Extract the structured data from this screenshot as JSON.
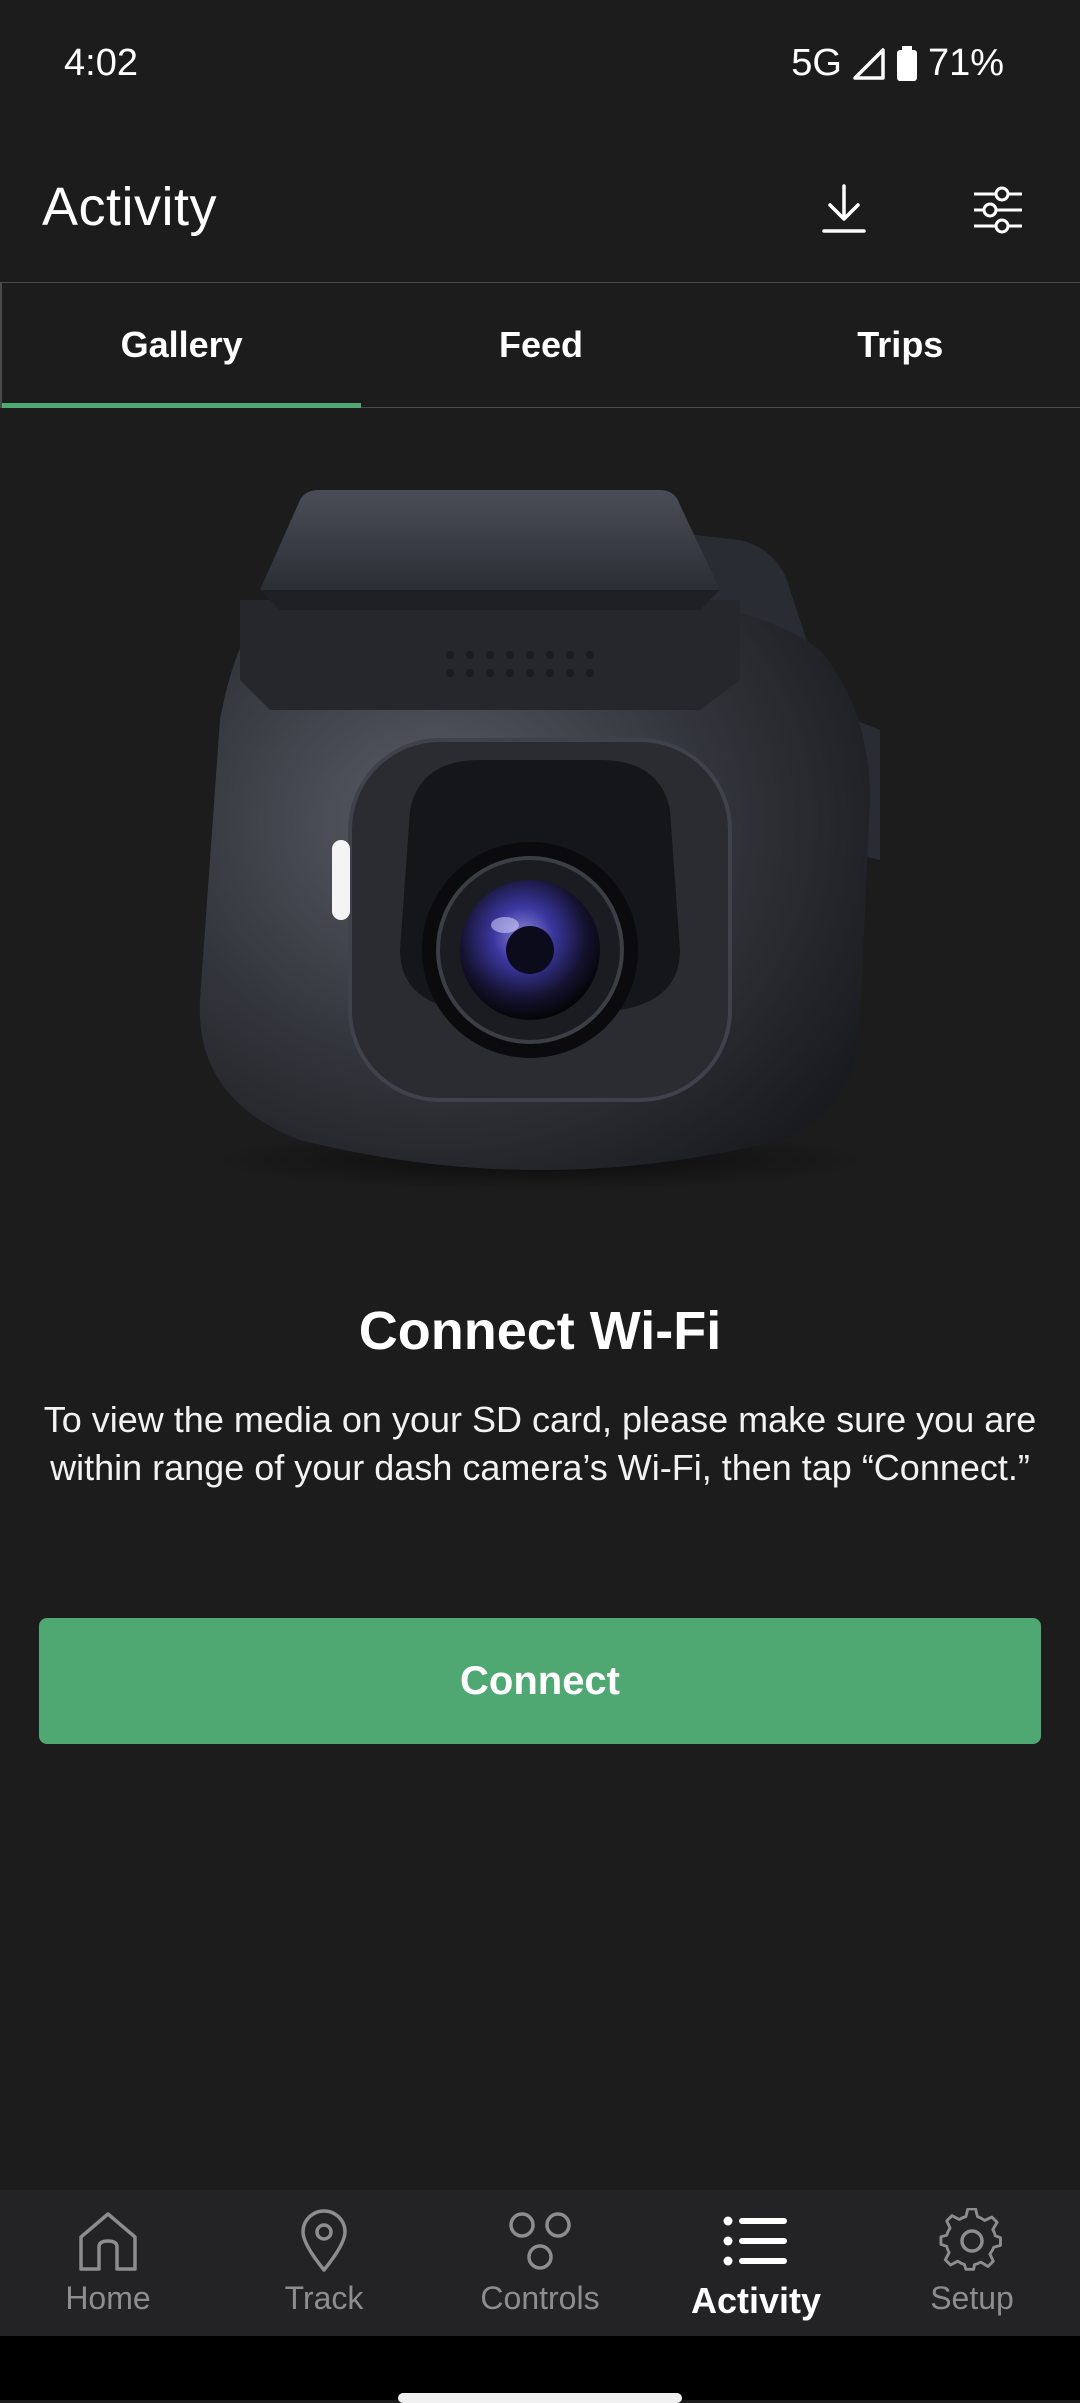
{
  "status": {
    "time": "4:02",
    "network": "5G",
    "battery": "71%"
  },
  "app_bar": {
    "title": "Activity",
    "download_icon": "download-icon",
    "filter_icon": "sliders-icon"
  },
  "tabs": [
    {
      "label": "Gallery",
      "active": true
    },
    {
      "label": "Feed",
      "active": false
    },
    {
      "label": "Trips",
      "active": false
    }
  ],
  "empty_state": {
    "title": "Connect Wi-Fi",
    "body": "To view the media on your SD card, please make sure you are within range of your dash camera’s Wi-Fi, then tap “Connect.”",
    "button": "Connect"
  },
  "bottom_nav": [
    {
      "label": "Home",
      "icon": "home-icon",
      "active": false
    },
    {
      "label": "Track",
      "icon": "map-pin-icon",
      "active": false
    },
    {
      "label": "Controls",
      "icon": "controls-icon",
      "active": false
    },
    {
      "label": "Activity",
      "icon": "list-icon",
      "active": true
    },
    {
      "label": "Setup",
      "icon": "gear-icon",
      "active": false
    }
  ],
  "colors": {
    "background": "#1c1c1d",
    "accent": "#4fa872",
    "nav_background": "#232325",
    "inactive": "#8d8d90"
  }
}
